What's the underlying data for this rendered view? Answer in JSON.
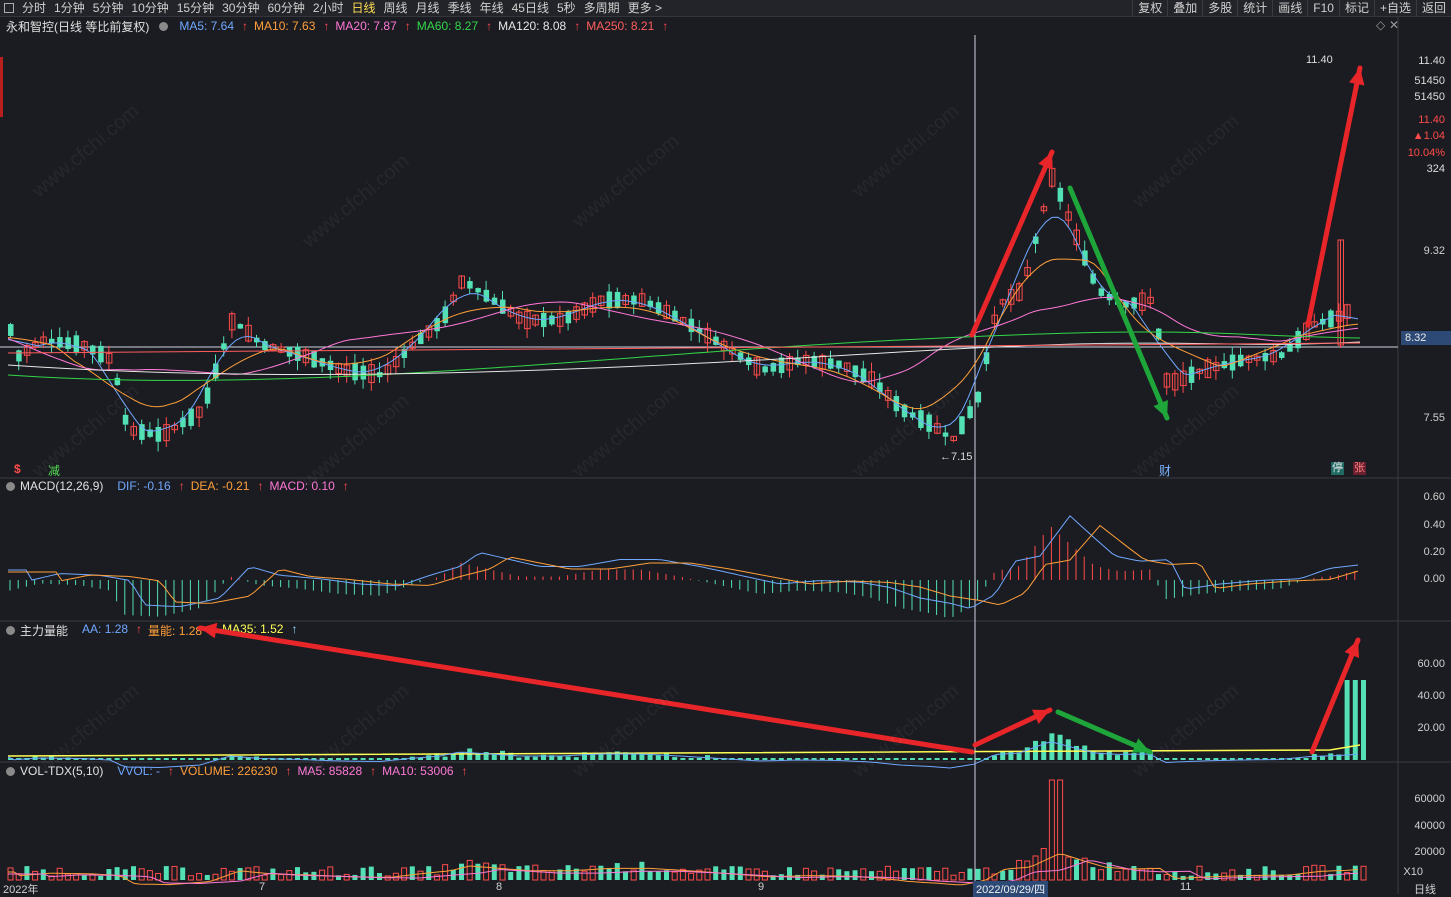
{
  "toolbar": {
    "periods": [
      "分时",
      "1分钟",
      "5分钟",
      "10分钟",
      "15分钟",
      "30分钟",
      "60分钟",
      "2小时",
      "日线",
      "周线",
      "月线",
      "季线",
      "年线",
      "45日线",
      "5秒",
      "多周期",
      "更多 >"
    ],
    "active_period": "日线",
    "right_items": [
      "复权",
      "叠加",
      "多股",
      "统计",
      "画线",
      "F10",
      "标记",
      "+自选",
      "返回"
    ]
  },
  "main_panel": {
    "title": "永和智控(日线 等比前复权)",
    "ma": [
      {
        "label": "MA5: 7.64",
        "color": "#6fa8ff"
      },
      {
        "label": "MA10: 7.63",
        "color": "#ff9f3a"
      },
      {
        "label": "MA20: 7.87",
        "color": "#ff78d8"
      },
      {
        "label": "MA60: 8.27",
        "color": "#33d64a"
      },
      {
        "label": "MA120: 8.08",
        "color": "#e6e6e6"
      },
      {
        "label": "MA250: 8.21",
        "color": "#ff5d5d"
      }
    ],
    "y_labels": [
      "11.40",
      "51450",
      "11.40",
      "▲1.04",
      "10.04%",
      "324",
      "9.32",
      "8.32",
      "7.55"
    ],
    "price_tags": {
      "high": "11.40",
      "low": "←7.15",
      "crosshair": "8.32"
    },
    "markers": {
      "s": "$",
      "jian": "减",
      "cai": "财",
      "ting": "停",
      "zhang": "张"
    }
  },
  "macd_panel": {
    "title": "MACD(12,26,9)",
    "values": [
      {
        "label": "DIF: -0.16",
        "color": "#6fa8ff"
      },
      {
        "label": "DEA: -0.21",
        "color": "#ff9f3a"
      },
      {
        "label": "MACD: 0.10",
        "color": "#ff78d8"
      }
    ],
    "y_labels": [
      "0.60",
      "0.40",
      "0.20",
      "0.00"
    ]
  },
  "zlln_panel": {
    "title": "主力量能",
    "values": [
      {
        "label": "AA: 1.28",
        "color": "#6fa8ff"
      },
      {
        "label": "量能: 1.28",
        "color": "#ff9f3a"
      },
      {
        "label": "MA35: 1.52",
        "color": "#ffff55"
      }
    ],
    "y_labels": [
      "60.00",
      "40.00",
      "20.00"
    ]
  },
  "vol_panel": {
    "title": "VOL-TDX(5,10)",
    "values": [
      {
        "label": "VVOL: -",
        "color": "#6fa8ff"
      },
      {
        "label": "VOLUME: 226230",
        "color": "#ff9f3a"
      },
      {
        "label": "MA5: 85828",
        "color": "#ff78d8"
      },
      {
        "label": "MA10: 53006",
        "color": "#ff78d8"
      }
    ],
    "y_labels": [
      "60000",
      "40000",
      "20000",
      "X10"
    ]
  },
  "x_axis": [
    "2022年",
    "7",
    "8",
    "9",
    "2022/09/29/四",
    "11",
    "日线"
  ],
  "watermark": "www.cfchi.com",
  "colors": {
    "up": "#ff4b4b",
    "down": "#52e0b4",
    "bg": "#1b1c21",
    "arrow_red": "#e8262a",
    "arrow_green": "#1fa63a"
  }
}
